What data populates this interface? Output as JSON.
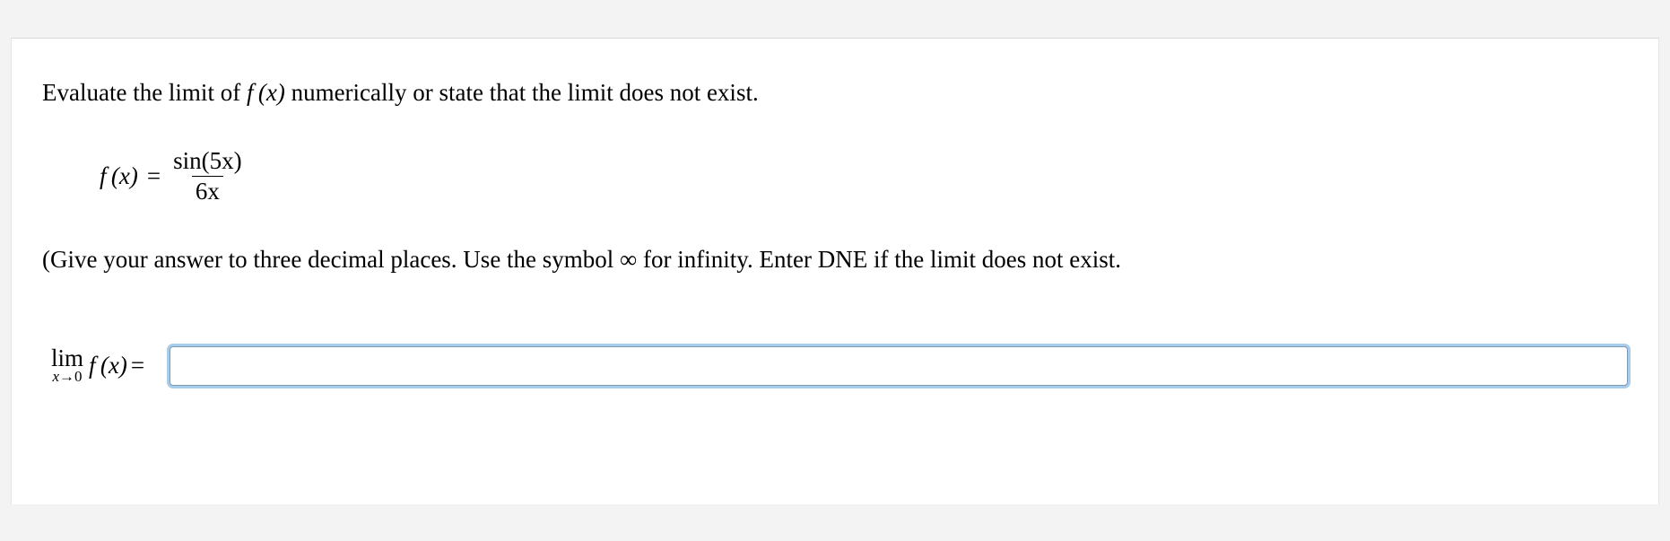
{
  "question": {
    "prompt_prefix": "Evaluate the limit of ",
    "prompt_fx": "f (x)",
    "prompt_suffix": " numerically or state that the limit does not exist.",
    "equation": {
      "lhs": "f (x)",
      "eq": " = ",
      "numerator": "sin(5x)",
      "denominator": "6x"
    },
    "instruction": "(Give your answer to three decimal places. Use the symbol ∞ for infinity. Enter DNE if the limit does not exist.",
    "answer": {
      "lim_label": "lim",
      "lim_sub_var": "x",
      "lim_sub_arrow": "→",
      "lim_sub_target": "0",
      "fx": "f (x)",
      "eq": " = ",
      "input_value": ""
    }
  }
}
